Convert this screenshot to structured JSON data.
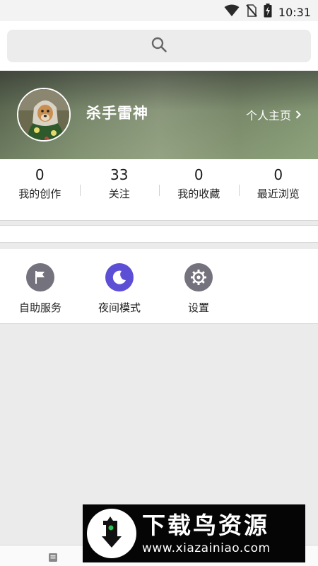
{
  "status_bar": {
    "time": "10:31",
    "icons": [
      "wifi-icon",
      "no-sim-icon",
      "battery-charging-icon"
    ]
  },
  "search": {
    "icon": "search-icon"
  },
  "profile": {
    "username": "杀手雷神",
    "homepage_label": "个人主页",
    "homepage_icon": "chevron-right-icon",
    "avatar": "user-avatar"
  },
  "stats": [
    {
      "value": "0",
      "label": "我的创作"
    },
    {
      "value": "33",
      "label": "关注"
    },
    {
      "value": "0",
      "label": "我的收藏"
    },
    {
      "value": "0",
      "label": "最近浏览"
    }
  ],
  "tools": [
    {
      "label": "自助服务",
      "icon": "flag-icon",
      "color": "#73727d"
    },
    {
      "label": "夜间模式",
      "icon": "moon-icon",
      "color": "#5c4fd6"
    },
    {
      "label": "设置",
      "icon": "gear-icon",
      "color": "#73727d"
    }
  ],
  "watermark": {
    "title": "下载鸟资源",
    "url": "www.xiazainiao.com"
  },
  "colors": {
    "night_mode_accent": "#5c4fd6",
    "icon_gray": "#73727d",
    "page_background": "#ebebeb"
  }
}
